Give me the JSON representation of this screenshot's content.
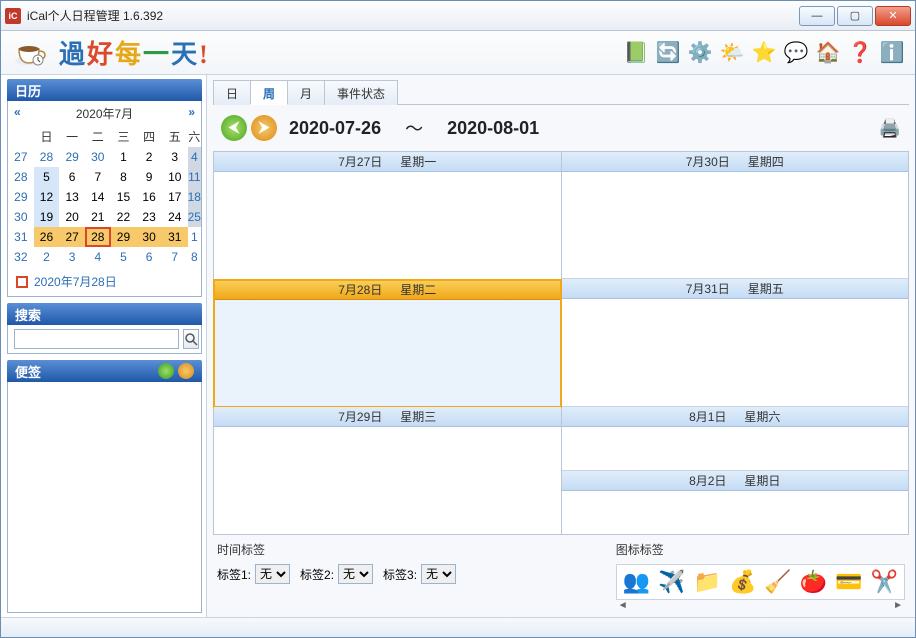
{
  "window": {
    "title": "iCal个人日程管理   1.6.392"
  },
  "logo": {
    "chars": [
      "過",
      "好",
      "每",
      "一",
      "天",
      "!"
    ]
  },
  "toolbar_icons": [
    "book-icon",
    "sync-icon",
    "gear-icon",
    "weather-icon",
    "star-icon",
    "chat-icon",
    "home-icon",
    "help-icon",
    "info-icon"
  ],
  "toolbar_glyphs": [
    "📗",
    "🔄",
    "⚙️",
    "🌤️",
    "⭐",
    "💬",
    "🏠",
    "❓",
    "ℹ️"
  ],
  "sidebar": {
    "calendar_title": "日历",
    "month_label": "2020年7月",
    "prev": "«",
    "next": "»",
    "dow": [
      "日",
      "一",
      "二",
      "三",
      "四",
      "五",
      "六"
    ],
    "today_label": "2020年7月28日",
    "search_title": "搜索",
    "notes_title": "便签"
  },
  "minical": {
    "weeks": [
      {
        "wk": "27",
        "days": [
          {
            "n": "28",
            "cls": "other"
          },
          {
            "n": "29",
            "cls": "other"
          },
          {
            "n": "30",
            "cls": "other"
          },
          {
            "n": "1",
            "cls": ""
          },
          {
            "n": "2",
            "cls": ""
          },
          {
            "n": "3",
            "cls": ""
          },
          {
            "n": "4",
            "cls": "greyed"
          }
        ]
      },
      {
        "wk": "28",
        "days": [
          {
            "n": "5",
            "cls": "this"
          },
          {
            "n": "6",
            "cls": ""
          },
          {
            "n": "7",
            "cls": ""
          },
          {
            "n": "8",
            "cls": ""
          },
          {
            "n": "9",
            "cls": ""
          },
          {
            "n": "10",
            "cls": ""
          },
          {
            "n": "11",
            "cls": "greyed"
          }
        ]
      },
      {
        "wk": "29",
        "days": [
          {
            "n": "12",
            "cls": "this"
          },
          {
            "n": "13",
            "cls": ""
          },
          {
            "n": "14",
            "cls": ""
          },
          {
            "n": "15",
            "cls": ""
          },
          {
            "n": "16",
            "cls": ""
          },
          {
            "n": "17",
            "cls": ""
          },
          {
            "n": "18",
            "cls": "greyed"
          }
        ]
      },
      {
        "wk": "30",
        "days": [
          {
            "n": "19",
            "cls": "this"
          },
          {
            "n": "20",
            "cls": ""
          },
          {
            "n": "21",
            "cls": ""
          },
          {
            "n": "22",
            "cls": ""
          },
          {
            "n": "23",
            "cls": ""
          },
          {
            "n": "24",
            "cls": ""
          },
          {
            "n": "25",
            "cls": "greyed"
          }
        ]
      },
      {
        "wk": "31",
        "days": [
          {
            "n": "26",
            "cls": "sel-range"
          },
          {
            "n": "27",
            "cls": "sel-range"
          },
          {
            "n": "28",
            "cls": "today"
          },
          {
            "n": "29",
            "cls": "sel-range"
          },
          {
            "n": "30",
            "cls": "sel-range"
          },
          {
            "n": "31",
            "cls": "sel-range"
          },
          {
            "n": "1",
            "cls": "other"
          }
        ]
      },
      {
        "wk": "32",
        "days": [
          {
            "n": "2",
            "cls": "other"
          },
          {
            "n": "3",
            "cls": "other"
          },
          {
            "n": "4",
            "cls": "other"
          },
          {
            "n": "5",
            "cls": "other"
          },
          {
            "n": "6",
            "cls": "other"
          },
          {
            "n": "7",
            "cls": "other"
          },
          {
            "n": "8",
            "cls": "other"
          }
        ]
      }
    ]
  },
  "tabs": {
    "day": "日",
    "week": "周",
    "month": "月",
    "status": "事件状态",
    "active": "week"
  },
  "range": {
    "start": "2020-07-26",
    "sep": "〜",
    "end": "2020-08-01"
  },
  "week": {
    "left": [
      {
        "date": "7月27日",
        "dow": "星期一",
        "sel": false
      },
      {
        "date": "7月28日",
        "dow": "星期二",
        "sel": true
      },
      {
        "date": "7月29日",
        "dow": "星期三",
        "sel": false
      }
    ],
    "right": [
      {
        "date": "7月30日",
        "dow": "星期四",
        "half": false
      },
      {
        "date": "7月31日",
        "dow": "星期五",
        "half": false
      },
      {
        "date": "8月1日",
        "dow": "星期六",
        "half": true
      },
      {
        "date": "8月2日",
        "dow": "星期日",
        "half": true
      }
    ]
  },
  "bottom": {
    "time_tags_title": "时间标签",
    "icon_tags_title": "图标标签",
    "tag1_label": "标签1:",
    "tag2_label": "标签2:",
    "tag3_label": "标签3:",
    "tag_options": [
      "无"
    ],
    "tag1_value": "无",
    "tag2_value": "无",
    "tag3_value": "无",
    "icons": [
      "👥",
      "✈️",
      "📁",
      "💰",
      "🧹",
      "🍅",
      "💳",
      "✂️"
    ]
  }
}
